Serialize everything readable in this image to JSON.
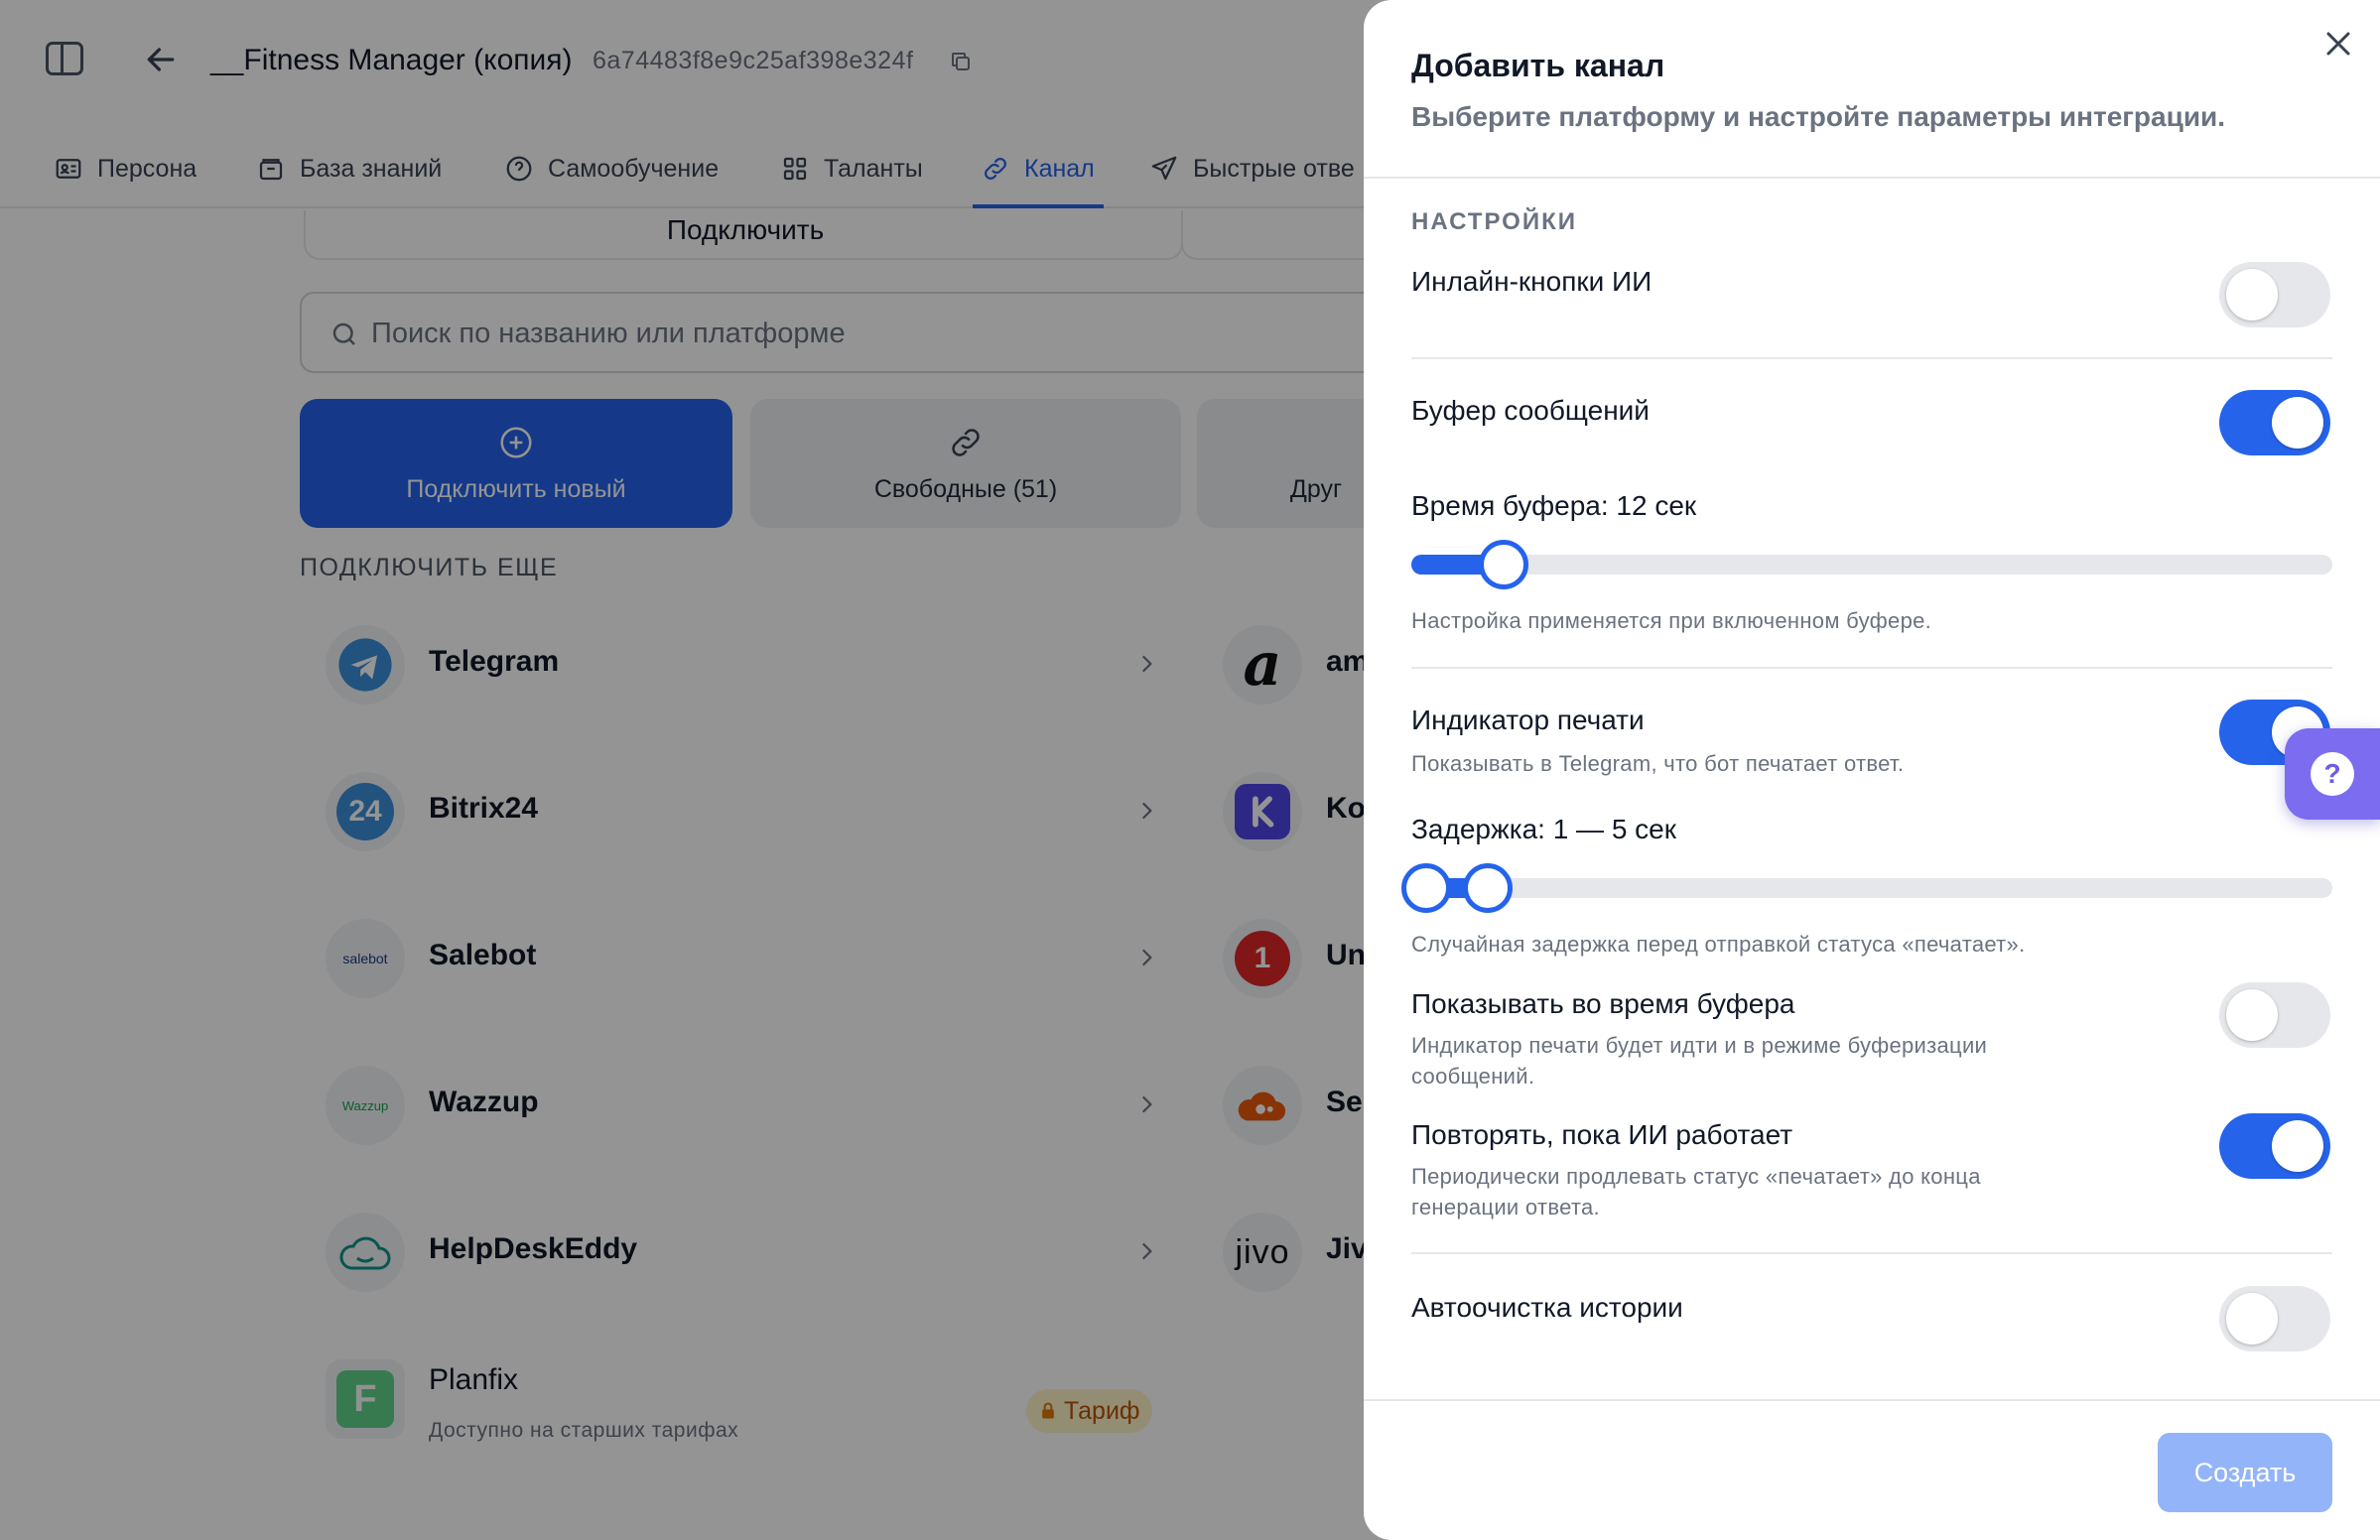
{
  "app": {
    "title": "__Fitness Manager (копия)",
    "id": "6a74483f8e9c25af398e324f"
  },
  "tabs": [
    {
      "label": "Персона",
      "icon": "persona-icon"
    },
    {
      "label": "База знаний",
      "icon": "knowledge-base-icon"
    },
    {
      "label": "Самообучение",
      "icon": "help-circle-icon"
    },
    {
      "label": "Таланты",
      "icon": "grid-icon"
    },
    {
      "label": "Канал",
      "icon": "link-icon",
      "active": true
    },
    {
      "label": "Быстрые отве",
      "icon": "send-icon"
    }
  ],
  "connect_card": {
    "label": "Подключить"
  },
  "search": {
    "placeholder": "Поиск по названию или платформе"
  },
  "filters": [
    {
      "label": "Подключить новый",
      "icon": "plus-circle-icon"
    },
    {
      "label": "Свободные (51)",
      "icon": "link-icon"
    },
    {
      "label": "Друг",
      "icon": ""
    }
  ],
  "section_title": "ПОДКЛЮЧИТЬ ЕЩЕ",
  "channels_left": [
    {
      "name": "Telegram",
      "logo": "telegram-logo"
    },
    {
      "name": "Bitrix24",
      "logo": "bitrix24-logo",
      "logo_text": "24"
    },
    {
      "name": "Salebot",
      "logo": "salebot-logo",
      "logo_text": "salebot"
    },
    {
      "name": "Wazzup",
      "logo": "wazzup-logo",
      "logo_text": "Wazzup"
    },
    {
      "name": "HelpDeskEddy",
      "logo": "cloud-logo"
    },
    {
      "name": "Planfix",
      "logo": "planfix-logo",
      "subtitle": "Доступно на старших тарифах",
      "badge": "Тариф"
    }
  ],
  "channels_right": [
    {
      "name": "am",
      "logo": "amocrm-logo",
      "logo_text": "a"
    },
    {
      "name": "Ko",
      "logo": "kommo-logo"
    },
    {
      "name": "Un",
      "logo": "unisender-logo",
      "logo_text": "1"
    },
    {
      "name": "Se",
      "logo": "sendpulse-logo"
    },
    {
      "name": "Jiv",
      "logo": "jivo-logo",
      "logo_text": "jivo"
    }
  ],
  "drawer": {
    "title": "Добавить канал",
    "subtitle": "Выберите платформу и настройте параметры интеграции.",
    "settings_title": "НАСТРОЙКИ",
    "settings": {
      "inline_buttons": {
        "label": "Инлайн-кнопки ИИ",
        "enabled": false
      },
      "message_buffer": {
        "label": "Буфер сообщений",
        "enabled": true
      },
      "buffer_time": {
        "label": "Время буфера: 12 сек",
        "value_sec": 12,
        "min": 0,
        "max": 120,
        "hint": "Настройка применяется при включенном буфере."
      },
      "typing_indicator": {
        "label": "Индикатор печати",
        "desc": "Показывать в Telegram, что бот печатает ответ.",
        "enabled": true
      },
      "delay": {
        "label": "Задержка: 1 — 5 сек",
        "min_sec": 1,
        "max_sec": 5,
        "range_min": 0,
        "range_max": 60,
        "hint": "Случайная задержка перед отправкой статуса «печатает»."
      },
      "show_during_buffer": {
        "label": "Показывать во время буфера",
        "desc": "Индикатор печати будет идти и в режиме буферизации сообщений.",
        "enabled": false
      },
      "repeat_while_ai": {
        "label": "Повторять, пока ИИ работает",
        "desc": "Периодически продлевать статус «печатает» до конца генерации ответа.",
        "enabled": true
      },
      "auto_cleanup": {
        "label": "Автоочистка истории",
        "enabled": false
      }
    },
    "create_label": "Создать"
  },
  "help": {
    "label": "?"
  },
  "colors": {
    "accent": "#2563eb",
    "toggle_off": "#e5e7eb",
    "create_disabled": "#93b4f8",
    "help_fab": "#7c6cf0"
  }
}
